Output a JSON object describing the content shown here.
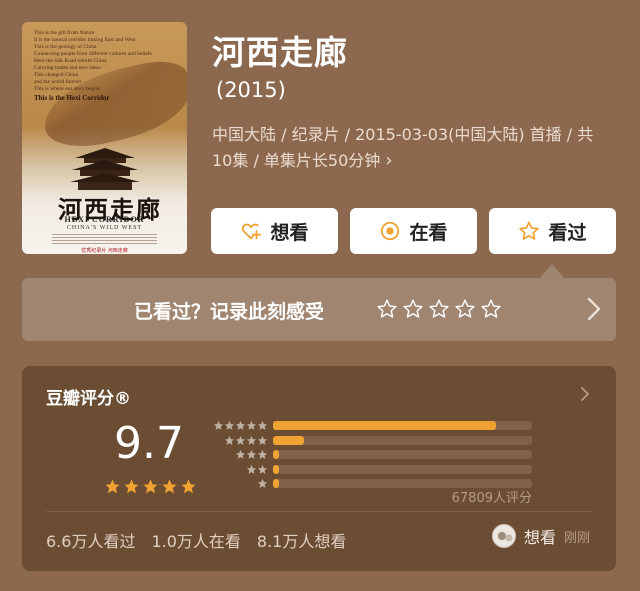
{
  "poster": {
    "blurb": [
      "This is the gift from Nature",
      "It is the natural corridor linking East and West",
      "This is the geology of China",
      "Connecting people from different cultures and beliefs",
      "Here the Silk Road rebirth China",
      "Carrying trades and new ideas",
      "This changed China",
      "and the world forever",
      "This is where our story begins"
    ],
    "blurb_strong": "This is the Hexi Corridor",
    "calligraphy": "河西走廊",
    "subtitle_en": "HEXI CORRIDOR",
    "subtitle_en2": "CHINA'S WILD WEST",
    "credit": "优秀纪录片  河西走廊"
  },
  "title": "河西走廊",
  "year": "(2015)",
  "meta": "中国大陆 / 纪录片 / 2015-03-03(中国大陆) 首播 / 共10集 / 单集片长50分钟",
  "meta_more_icon": "chevron-right-icon",
  "buttons": {
    "want": "想看",
    "watching": "在看",
    "watched": "看过"
  },
  "rate_prompt": {
    "label": "已看过？记录此刻感受",
    "star_count": 5
  },
  "douban": {
    "header": "豆瓣评分®",
    "score": "9.7",
    "stars": 5,
    "distribution": [
      0.86,
      0.12,
      0.02,
      0.005,
      0.005
    ],
    "votes": "67809人评分",
    "stats": [
      "6.6万人看过",
      "1.0万人在看",
      "8.1万人想看"
    ],
    "friend_label": "想看",
    "friend_time": "刚刚"
  },
  "colors": {
    "background": "#8b684e",
    "panel": "#6b4d34",
    "accent": "#f0a332",
    "button_icon": "#f0a332"
  }
}
